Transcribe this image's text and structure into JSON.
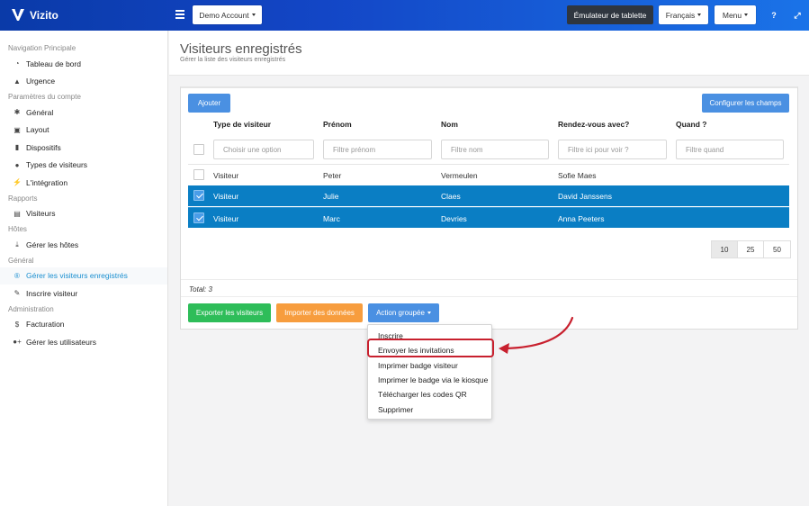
{
  "brand": {
    "name": "Vizito"
  },
  "topbar": {
    "account_label": "Demo Account",
    "tablet_label": "Émulateur de tablette",
    "language_label": "Français",
    "menu_label": "Menu",
    "help_icon": "question-icon",
    "expand_icon": "expand-icon"
  },
  "sidebar": {
    "sections": [
      {
        "title": "Navigation Principale",
        "items": [
          {
            "label": "Tableau de bord",
            "icon": "dashboard-icon"
          },
          {
            "label": "Urgence",
            "icon": "warning-icon"
          }
        ]
      },
      {
        "title": "Paramètres du compte",
        "items": [
          {
            "label": "Général",
            "icon": "gear-icon"
          },
          {
            "label": "Layout",
            "icon": "image-icon"
          },
          {
            "label": "Dispositifs",
            "icon": "tablet-icon"
          },
          {
            "label": "Types de visiteurs",
            "icon": "users-icon"
          },
          {
            "label": "L'intégration",
            "icon": "plug-icon"
          }
        ]
      },
      {
        "title": "Rapports",
        "items": [
          {
            "label": "Visiteurs",
            "icon": "book-icon"
          }
        ]
      },
      {
        "title": "Hôtes",
        "items": [
          {
            "label": "Gérer les hôtes",
            "icon": "download-icon"
          }
        ]
      },
      {
        "title": "Général",
        "items": [
          {
            "label": "Gérer les visiteurs enregistrés",
            "icon": "circle-r-icon",
            "active": true
          },
          {
            "label": "Inscrire visiteur",
            "icon": "pencil-icon"
          }
        ]
      },
      {
        "title": "Administration",
        "items": [
          {
            "label": "Facturation",
            "icon": "dollar-icon"
          },
          {
            "label": "Gérer les utilisateurs",
            "icon": "user-plus-icon"
          }
        ]
      }
    ]
  },
  "page": {
    "title": "Visiteurs enregistrés",
    "subtitle": "Gérer la liste des visiteurs enregistrés"
  },
  "toolbar": {
    "add_label": "Ajouter",
    "configure_label": "Configurer les champs"
  },
  "table": {
    "columns": [
      "Type de visiteur",
      "Prénom",
      "Nom",
      "Rendez-vous avec?",
      "Quand ?"
    ],
    "filters": {
      "type_placeholder": "Choisir une option",
      "prenom_placeholder": "Filtre prénom",
      "nom_placeholder": "Filtre nom",
      "rdv_placeholder": "Filtre ici pour voir ?",
      "quand_placeholder": "Filtre quand"
    },
    "rows": [
      {
        "type": "Visiteur",
        "prenom": "Peter",
        "nom": "Vermeulen",
        "rdv": "Sofie Maes",
        "quand": "",
        "selected": false
      },
      {
        "type": "Visiteur",
        "prenom": "Julie",
        "nom": "Claes",
        "rdv": "David Janssens",
        "quand": "",
        "selected": true
      },
      {
        "type": "Visiteur",
        "prenom": "Marc",
        "nom": "Devries",
        "rdv": "Anna Peeters",
        "quand": "",
        "selected": true
      }
    ],
    "page_sizes": [
      "10",
      "25",
      "50"
    ],
    "current_page_size": "10",
    "total": "Total: 3"
  },
  "actions": {
    "export_label": "Exporter les visiteurs",
    "import_label": "Importer des données",
    "bulk_label": "Action groupée"
  },
  "bulk_menu": {
    "items": [
      "Inscrire",
      "Envoyer les invitations",
      "Imprimer badge visiteur",
      "Imprimer le badge via le kiosque",
      "Télécharger les codes QR",
      "Supprimer"
    ],
    "highlighted_index": 1
  },
  "colors": {
    "selected_row": "#0a7ec4",
    "highlight": "#c8202e",
    "active_nav": "#1a8fd0"
  }
}
